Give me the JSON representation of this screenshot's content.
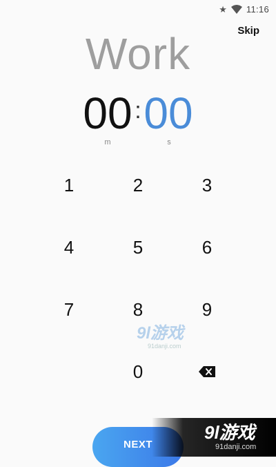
{
  "status_bar": {
    "time": "11:16",
    "icons": [
      "star-icon",
      "wifi-icon"
    ]
  },
  "header": {
    "skip_label": "Skip",
    "title": "Work"
  },
  "timer": {
    "minutes": "00",
    "separator": ":",
    "seconds": "00",
    "minutes_unit": "m",
    "seconds_unit": "s"
  },
  "keypad": {
    "keys": [
      "1",
      "2",
      "3",
      "4",
      "5",
      "6",
      "7",
      "8",
      "9",
      "0"
    ],
    "backspace_icon": "backspace-icon"
  },
  "footer": {
    "next_label": "NEXT"
  },
  "watermark": {
    "logo": "9l游戏",
    "url": "91danji.com"
  },
  "colors": {
    "accent": "#4a8cd8",
    "title_gray": "#9e9e9e",
    "button_start": "#4aa6f0",
    "button_end": "#3b78e8"
  }
}
